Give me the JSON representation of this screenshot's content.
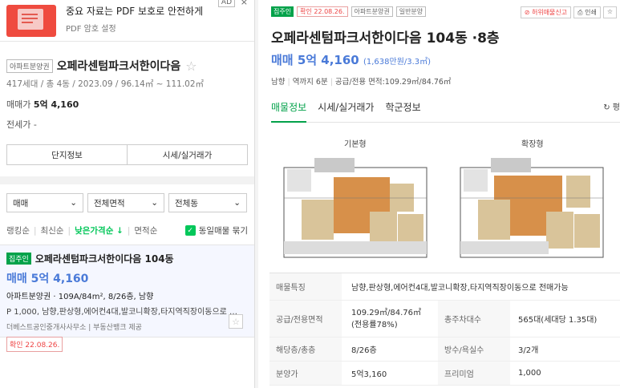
{
  "ad": {
    "title": "중요 자료는 PDF 보호로 안전하게",
    "sub": "PDF 암호 설정",
    "tag": "AD",
    "close": "×"
  },
  "complex": {
    "tag": "아파트분양권",
    "name": "오페라센텀파크서한이다음",
    "info": "417세대 / 총 4동 / 2023.09 / 96.14㎡ ~ 111.02㎡",
    "sale_label": "매매가",
    "sale_value": "5억 4,160",
    "jeonse": "전세가 -",
    "btn_info": "단지정보",
    "btn_price": "시세/실거래가"
  },
  "filters": {
    "deal": "매매",
    "area": "전체면적",
    "dong": "전체동"
  },
  "sort": {
    "s1": "랭킹순",
    "s2": "최신순",
    "s3": "낮은가격순",
    "s4": "면적순",
    "same": "동일매물 묶기"
  },
  "card": {
    "tag": "집주인",
    "name": "오페라센텀파크서한이다음 104동",
    "price": "매매 5억 4,160",
    "line1": "아파트분양권 · 109A/84m², 8/26층, 남향",
    "line2": "P 1,000, 남향,판상형,에어컨4대,발코니확장,타지역직장이동으로 …",
    "agents": "더베스트공인중개사사무소 | 부동산뱅크 제공",
    "confirm": "확인 22.08.26."
  },
  "detail": {
    "tag1": "집주인",
    "tag2": "확인 22.08.26.",
    "tag3": "아파트분양권",
    "tag4": "일반분양",
    "report": "허위매물신고",
    "print": "인쇄",
    "title": "오페라센텀파크서한이다음 104동 ·8층",
    "price": "매매 5억 4,160",
    "per": "(1,638만원/3.3㎡)",
    "dir": "남향",
    "station": "역까지 6분",
    "area": "공급/전용 면적:109.29㎡/84.76㎡",
    "tabs": [
      "매물정보",
      "시세/실거래가",
      "학군정보"
    ],
    "refresh": "↻ 평",
    "plan1": "기본형",
    "plan2": "확장형"
  },
  "table": [
    {
      "k": "매물특징",
      "v": "남향,판상형,에어컨4대,발코니확장,타지역직장이동으로 전매가능"
    },
    {
      "k": "공급/전용면적",
      "v": "109.29㎡/84.76㎡(전용률78%)",
      "k2": "총주차대수",
      "v2": "565대(세대당 1.35대)"
    },
    {
      "k": "해당층/총층",
      "v": "8/26층",
      "k2": "방수/욕실수",
      "v2": "3/2개"
    },
    {
      "k": "분양가",
      "v": "5억3,160",
      "k2": "프리미엄",
      "v2": "1,000"
    }
  ]
}
